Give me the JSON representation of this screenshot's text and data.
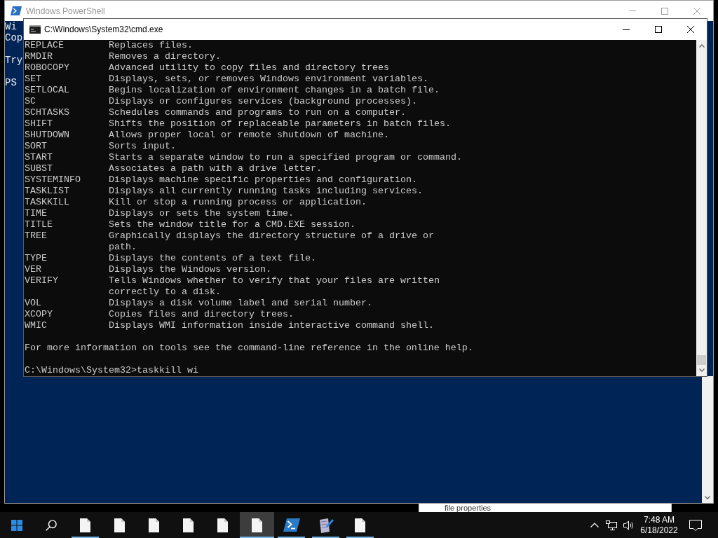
{
  "powershell_window": {
    "title": "Windows PowerShell",
    "active": false,
    "text_blocks": [
      [
        "Wi",
        "Cop"
      ],
      [
        "Try"
      ],
      [
        "PS"
      ]
    ]
  },
  "cmd_window": {
    "title": "C:\\Windows\\System32\\cmd.exe",
    "active": true,
    "commands": [
      {
        "command": "REPLACE",
        "description": [
          "Replaces files."
        ]
      },
      {
        "command": "RMDIR",
        "description": [
          "Removes a directory."
        ]
      },
      {
        "command": "ROBOCOPY",
        "description": [
          "Advanced utility to copy files and directory trees"
        ]
      },
      {
        "command": "SET",
        "description": [
          "Displays, sets, or removes Windows environment variables."
        ]
      },
      {
        "command": "SETLOCAL",
        "description": [
          "Begins localization of environment changes in a batch file."
        ]
      },
      {
        "command": "SC",
        "description": [
          "Displays or configures services (background processes)."
        ]
      },
      {
        "command": "SCHTASKS",
        "description": [
          "Schedules commands and programs to run on a computer."
        ]
      },
      {
        "command": "SHIFT",
        "description": [
          "Shifts the position of replaceable parameters in batch files."
        ]
      },
      {
        "command": "SHUTDOWN",
        "description": [
          "Allows proper local or remote shutdown of machine."
        ]
      },
      {
        "command": "SORT",
        "description": [
          "Sorts input."
        ]
      },
      {
        "command": "START",
        "description": [
          "Starts a separate window to run a specified program or command."
        ]
      },
      {
        "command": "SUBST",
        "description": [
          "Associates a path with a drive letter."
        ]
      },
      {
        "command": "SYSTEMINFO",
        "description": [
          "Displays machine specific properties and configuration."
        ]
      },
      {
        "command": "TASKLIST",
        "description": [
          "Displays all currently running tasks including services."
        ]
      },
      {
        "command": "TASKKILL",
        "description": [
          "Kill or stop a running process or application."
        ]
      },
      {
        "command": "TIME",
        "description": [
          "Displays or sets the system time."
        ]
      },
      {
        "command": "TITLE",
        "description": [
          "Sets the window title for a CMD.EXE session."
        ]
      },
      {
        "command": "TREE",
        "description": [
          "Graphically displays the directory structure of a drive or",
          "path."
        ]
      },
      {
        "command": "TYPE",
        "description": [
          "Displays the contents of a text file."
        ]
      },
      {
        "command": "VER",
        "description": [
          "Displays the Windows version."
        ]
      },
      {
        "command": "VERIFY",
        "description": [
          "Tells Windows whether to verify that your files are written",
          "correctly to a disk."
        ]
      },
      {
        "command": "VOL",
        "description": [
          "Displays a disk volume label and serial number."
        ]
      },
      {
        "command": "XCOPY",
        "description": [
          "Copies files and directory trees."
        ]
      },
      {
        "command": "WMIC",
        "description": [
          "Displays WMI information inside interactive command shell."
        ]
      }
    ],
    "note": "For more information on tools see the command-line reference in the online help.",
    "prompt": "C:\\Windows\\System32>taskkill wi"
  },
  "background_window": {
    "text": "file properties"
  },
  "taskbar": {
    "buttons": [
      {
        "kind": "start",
        "running": false,
        "selected": false
      },
      {
        "kind": "search",
        "running": false,
        "selected": false
      },
      {
        "kind": "file",
        "running": true,
        "selected": false
      },
      {
        "kind": "file",
        "running": false,
        "selected": false
      },
      {
        "kind": "file",
        "running": false,
        "selected": false
      },
      {
        "kind": "file",
        "running": false,
        "selected": false
      },
      {
        "kind": "file",
        "running": false,
        "selected": false
      },
      {
        "kind": "file",
        "running": true,
        "selected": true
      },
      {
        "kind": "powershell",
        "running": true,
        "selected": false
      },
      {
        "kind": "editor",
        "running": true,
        "selected": false
      },
      {
        "kind": "file",
        "running": true,
        "selected": false
      }
    ],
    "tray": {
      "time": "7:48 AM",
      "date": "6/18/2022"
    }
  }
}
